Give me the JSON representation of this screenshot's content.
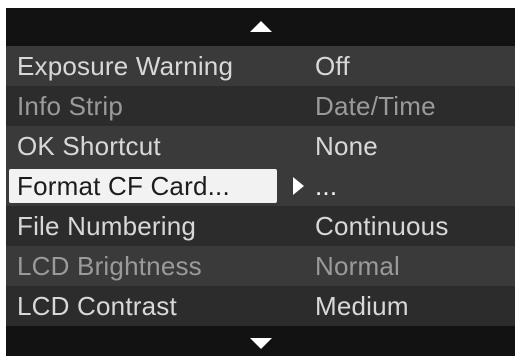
{
  "menu": {
    "items": [
      {
        "label": "Exposure Warning",
        "value": "Off",
        "tone": "light",
        "selected": false
      },
      {
        "label": "Info Strip",
        "value": "Date/Time",
        "tone": "dim",
        "selected": false
      },
      {
        "label": "OK Shortcut",
        "value": "None",
        "tone": "light",
        "selected": false
      },
      {
        "label": "Format CF Card...",
        "value": "...",
        "tone": "light",
        "selected": true
      },
      {
        "label": "File Numbering",
        "value": "Continuous",
        "tone": "light",
        "selected": false
      },
      {
        "label": "LCD Brightness",
        "value": "Normal",
        "tone": "dim",
        "selected": false
      },
      {
        "label": "LCD Contrast",
        "value": "Medium",
        "tone": "light",
        "selected": false
      }
    ]
  },
  "colors": {
    "background": "#121212",
    "row_dark": "#2c2c2c",
    "row_light": "#3a3a3a",
    "text_light": "#d8d8d8",
    "text_dim": "#9a9a9a",
    "highlight": "#f2f2f2"
  },
  "icons": {
    "scroll_up": "triangle-up-icon",
    "scroll_down": "triangle-down-icon",
    "submenu": "triangle-right-icon"
  }
}
